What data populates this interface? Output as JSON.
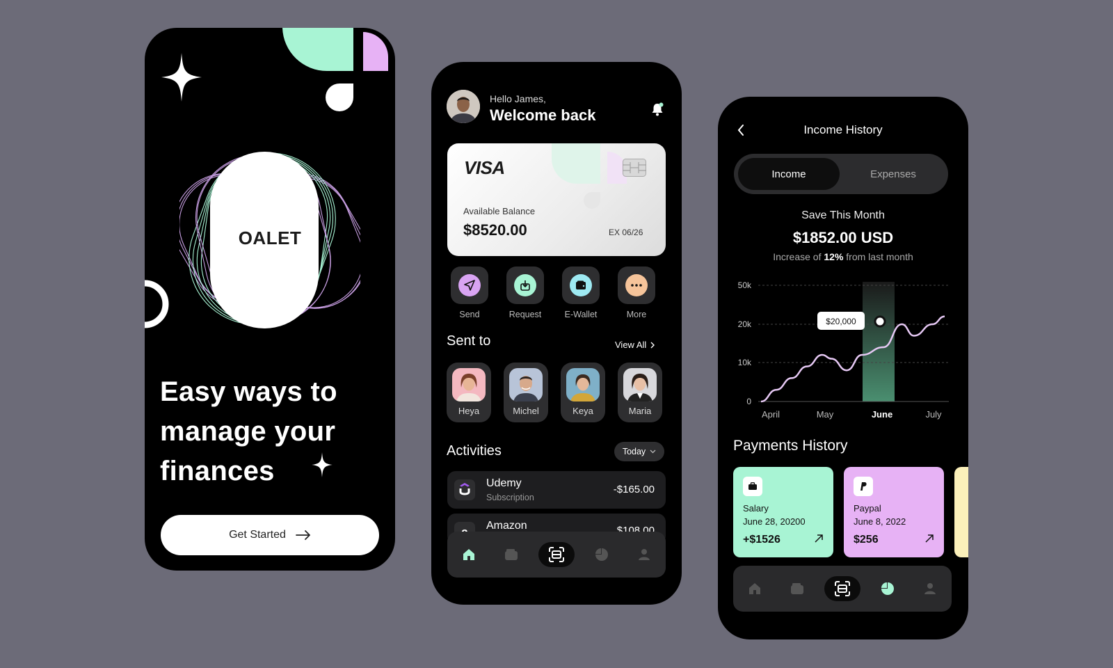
{
  "colors": {
    "background": "#6c6b78",
    "mint": "#a8f4d4",
    "lavender": "#e7b2f5",
    "card_yellow": "#fbf0ba",
    "surface": "#2e2e30"
  },
  "onboarding": {
    "logo": "OALET",
    "headline_lines": [
      "Easy ways to",
      "manage your",
      "finances"
    ],
    "cta_label": "Get Started",
    "icons": [
      "sparkle-icon",
      "arrow-right-icon"
    ]
  },
  "home": {
    "greeting": "Hello James,",
    "welcome": "Welcome back",
    "card": {
      "brand": "VISA",
      "balance_label": "Available Balance",
      "balance": "$8520.00",
      "expiry": "EX 06/26"
    },
    "quick_actions": [
      {
        "label": "Send",
        "icon": "send-icon",
        "color": "#d9a4f3"
      },
      {
        "label": "Request",
        "icon": "download-icon",
        "color": "#a8f4d4"
      },
      {
        "label": "E-Wallet",
        "icon": "wallet-icon",
        "color": "#9eeaf2"
      },
      {
        "label": "More",
        "icon": "more-icon",
        "color": "#f6c49a"
      }
    ],
    "sent_to": {
      "title": "Sent to",
      "view_all": "View All",
      "contacts": [
        {
          "name": "Heya",
          "bg": "#f4b8c0"
        },
        {
          "name": "Michel",
          "bg": "#b8c4d8"
        },
        {
          "name": "Keya",
          "bg": "#7fb0c8"
        },
        {
          "name": "Maria",
          "bg": "#d8d8dc"
        }
      ]
    },
    "activities": {
      "title": "Activities",
      "filter": "Today",
      "items": [
        {
          "icon_letter": "U",
          "name": "Udemy",
          "type": "Subscription",
          "amount": "-$165.00"
        },
        {
          "icon_letter": "a",
          "name": "Amazon",
          "type": "",
          "amount": "$108.00"
        }
      ]
    },
    "nav": [
      "home-icon",
      "wallet-icon",
      "scan-icon",
      "pie-chart-icon",
      "profile-icon"
    ]
  },
  "income": {
    "title": "Income History",
    "tabs": {
      "active": "Income",
      "inactive": "Expenses"
    },
    "save_label": "Save This Month",
    "amount": "$1852.00 USD",
    "increase_prefix": "Increase of ",
    "increase_value": "12%",
    "increase_suffix": " from last month",
    "chart_data": {
      "type": "line",
      "x": [
        "April",
        "May",
        "June",
        "July"
      ],
      "y_ticks": [
        "50k",
        "20k",
        "10k",
        "0"
      ],
      "highlight": "June",
      "tooltip": "$20,000",
      "grid": true,
      "points": [
        [
          0.0,
          0
        ],
        [
          0.25,
          3000
        ],
        [
          0.5,
          6000
        ],
        [
          0.75,
          9000
        ],
        [
          1.0,
          12000
        ],
        [
          1.15,
          11000
        ],
        [
          1.4,
          8000
        ],
        [
          1.65,
          12000
        ],
        [
          2.0,
          14000
        ],
        [
          2.3,
          20000
        ],
        [
          2.5,
          17000
        ],
        [
          2.8,
          20000
        ],
        [
          3.0,
          26000
        ]
      ]
    },
    "payments": {
      "title": "Payments History",
      "cards": [
        {
          "name": "Salary",
          "date": "June 28, 20200",
          "value": "+$1526",
          "icon": "briefcase-icon",
          "color": "#a8f4d4"
        },
        {
          "name": "Paypal",
          "date": "June 8, 2022",
          "value": "$256",
          "icon": "paypal-icon",
          "color": "#e7b2f5"
        }
      ]
    },
    "nav": [
      "home-icon",
      "wallet-icon",
      "scan-icon",
      "pie-chart-icon",
      "profile-icon"
    ]
  }
}
